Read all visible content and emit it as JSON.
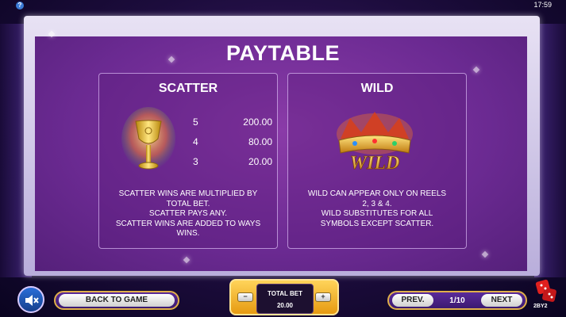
{
  "top_bar": {
    "clock": "17:59"
  },
  "title": "PAYTABLE",
  "scatter": {
    "title": "SCATTER",
    "payouts": [
      {
        "count": "5",
        "value": "200.00"
      },
      {
        "count": "4",
        "value": "80.00"
      },
      {
        "count": "3",
        "value": "20.00"
      }
    ],
    "lines": [
      "SCATTER WINS ARE MULTIPLIED BY",
      "TOTAL BET.",
      "SCATTER PAYS ANY.",
      "SCATTER WINS ARE ADDED TO WAYS",
      "WINS."
    ]
  },
  "wild": {
    "title": "WILD",
    "symbol_text": "WILD",
    "lines": [
      "WILD CAN APPEAR ONLY ON REELS",
      "2, 3 & 4.",
      "WILD SUBSTITUTES FOR ALL",
      "SYMBOLS EXCEPT SCATTER."
    ]
  },
  "controls": {
    "back_label": "BACK TO GAME",
    "total_bet_label": "TOTAL BET",
    "total_bet_value": "20.00",
    "prev_label": "PREV.",
    "page": "1/10",
    "next_label": "NEXT"
  },
  "logo_text": "2BY2",
  "colors": {
    "panel": "#6b2a92",
    "frame": "#d8cfee",
    "gold": "#e6a21a",
    "sound_button": "#2a6ed8"
  },
  "icons": [
    "help-icon",
    "sound-muted-icon",
    "goblet-icon",
    "crown-icon",
    "dice-logo-icon"
  ]
}
